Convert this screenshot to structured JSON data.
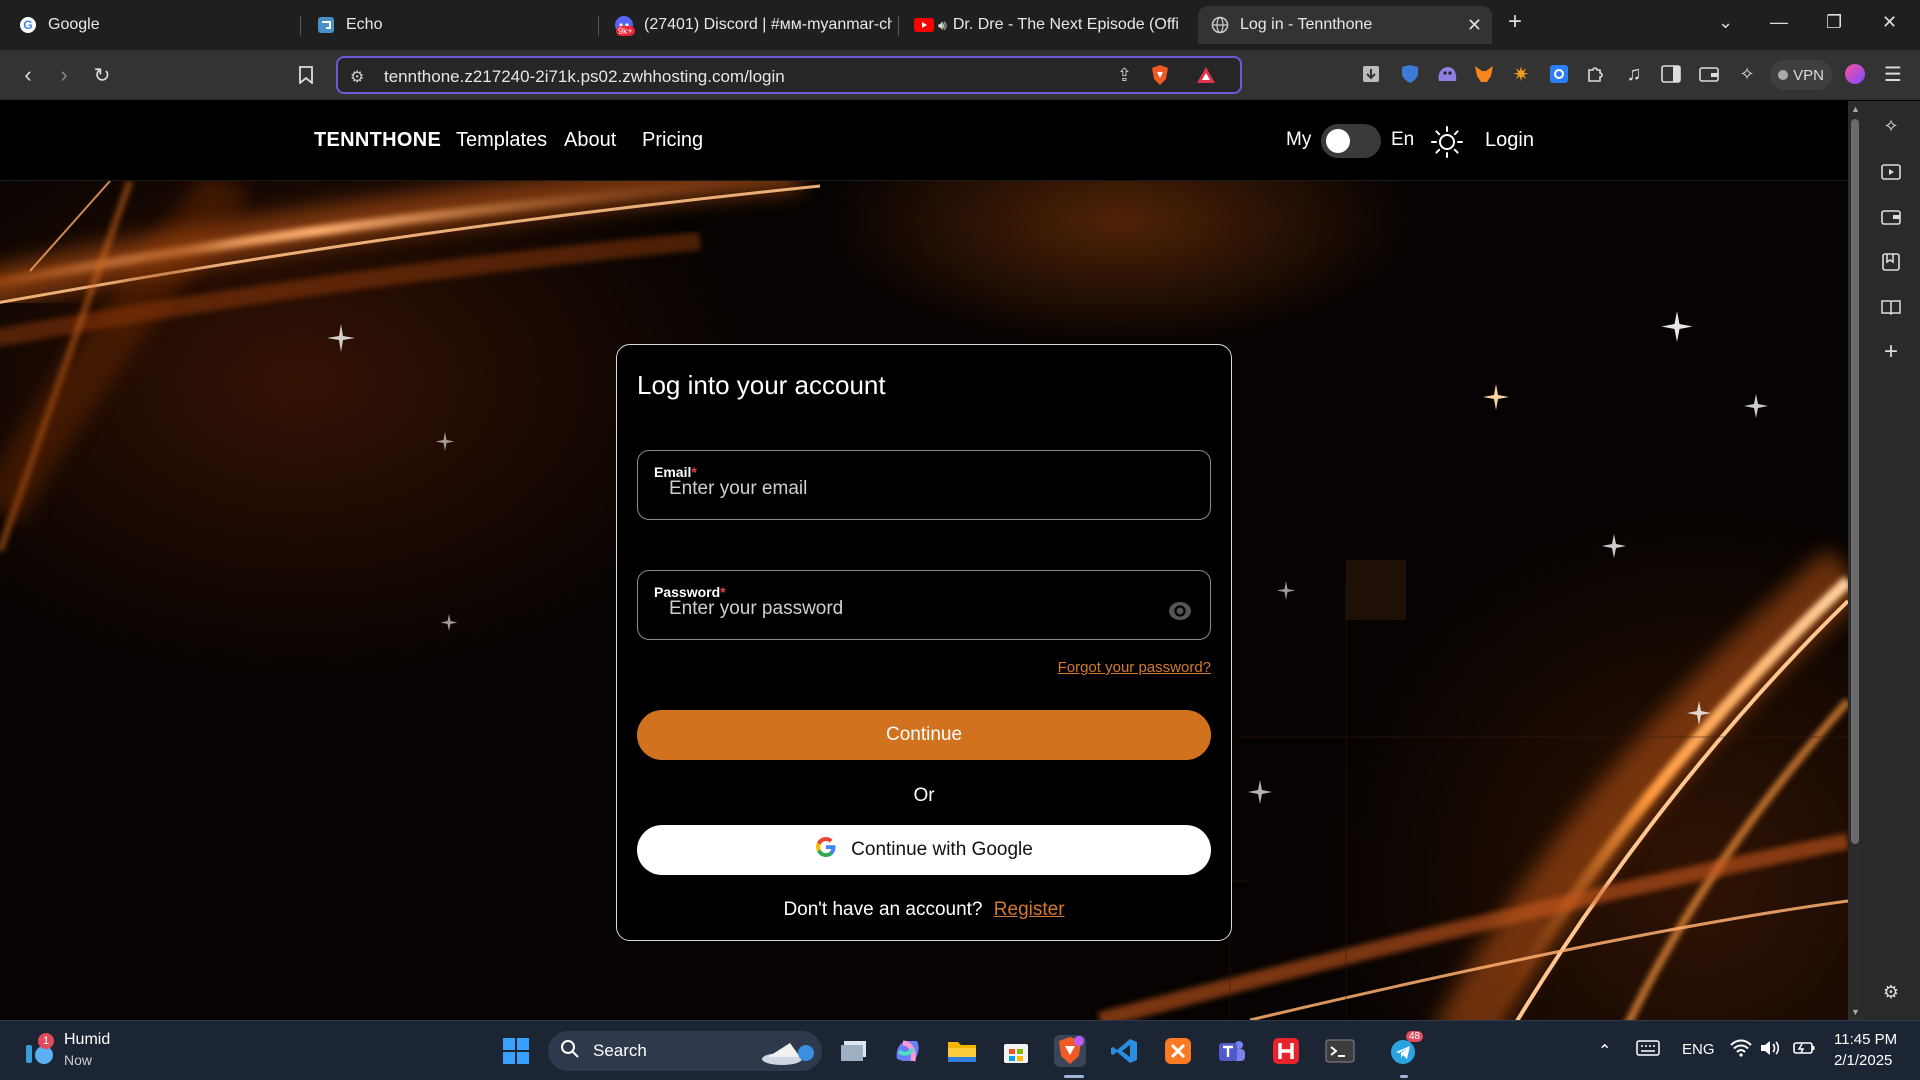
{
  "browser": {
    "tabs": [
      {
        "title": "Google",
        "favicon": "google-icon"
      },
      {
        "title": "Echo",
        "favicon": "echo-icon"
      },
      {
        "title": "(27401) Discord | #мм-myanmar-ch",
        "favicon": "discord-icon",
        "badge": "9k+"
      },
      {
        "title": "Dr. Dre - The Next Episode (Offi",
        "favicon": "youtube-icon"
      },
      {
        "title": "Log in - Tennthone",
        "favicon": "globe-icon",
        "active": true
      }
    ],
    "url": "tennthone.z217240-2i71k.ps02.zwhhosting.com/login",
    "vpn_label": "VPN"
  },
  "site": {
    "brand": "TENNTHONE",
    "nav": [
      "Templates",
      "About",
      "Pricing"
    ],
    "lang_left": "My",
    "lang_right": "En",
    "login_label": "Login"
  },
  "login": {
    "title": "Log into your account",
    "email_label": "Email",
    "email_placeholder": "Enter your email",
    "password_label": "Password",
    "password_placeholder": "Enter your password",
    "required_mark": "*",
    "forgot": "Forgot your password?",
    "continue": "Continue",
    "or": "Or",
    "google": "Continue with Google",
    "no_account": "Don't have an account?",
    "register": "Register"
  },
  "taskbar": {
    "weather_title": "Humid",
    "weather_sub": "Now",
    "weather_badge": "1",
    "search": "Search",
    "telegram_badge": "48",
    "lang": "ENG",
    "time": "11:45 PM",
    "date": "2/1/2025"
  },
  "colors": {
    "accent": "#d1721f",
    "link": "#d47a2e"
  }
}
